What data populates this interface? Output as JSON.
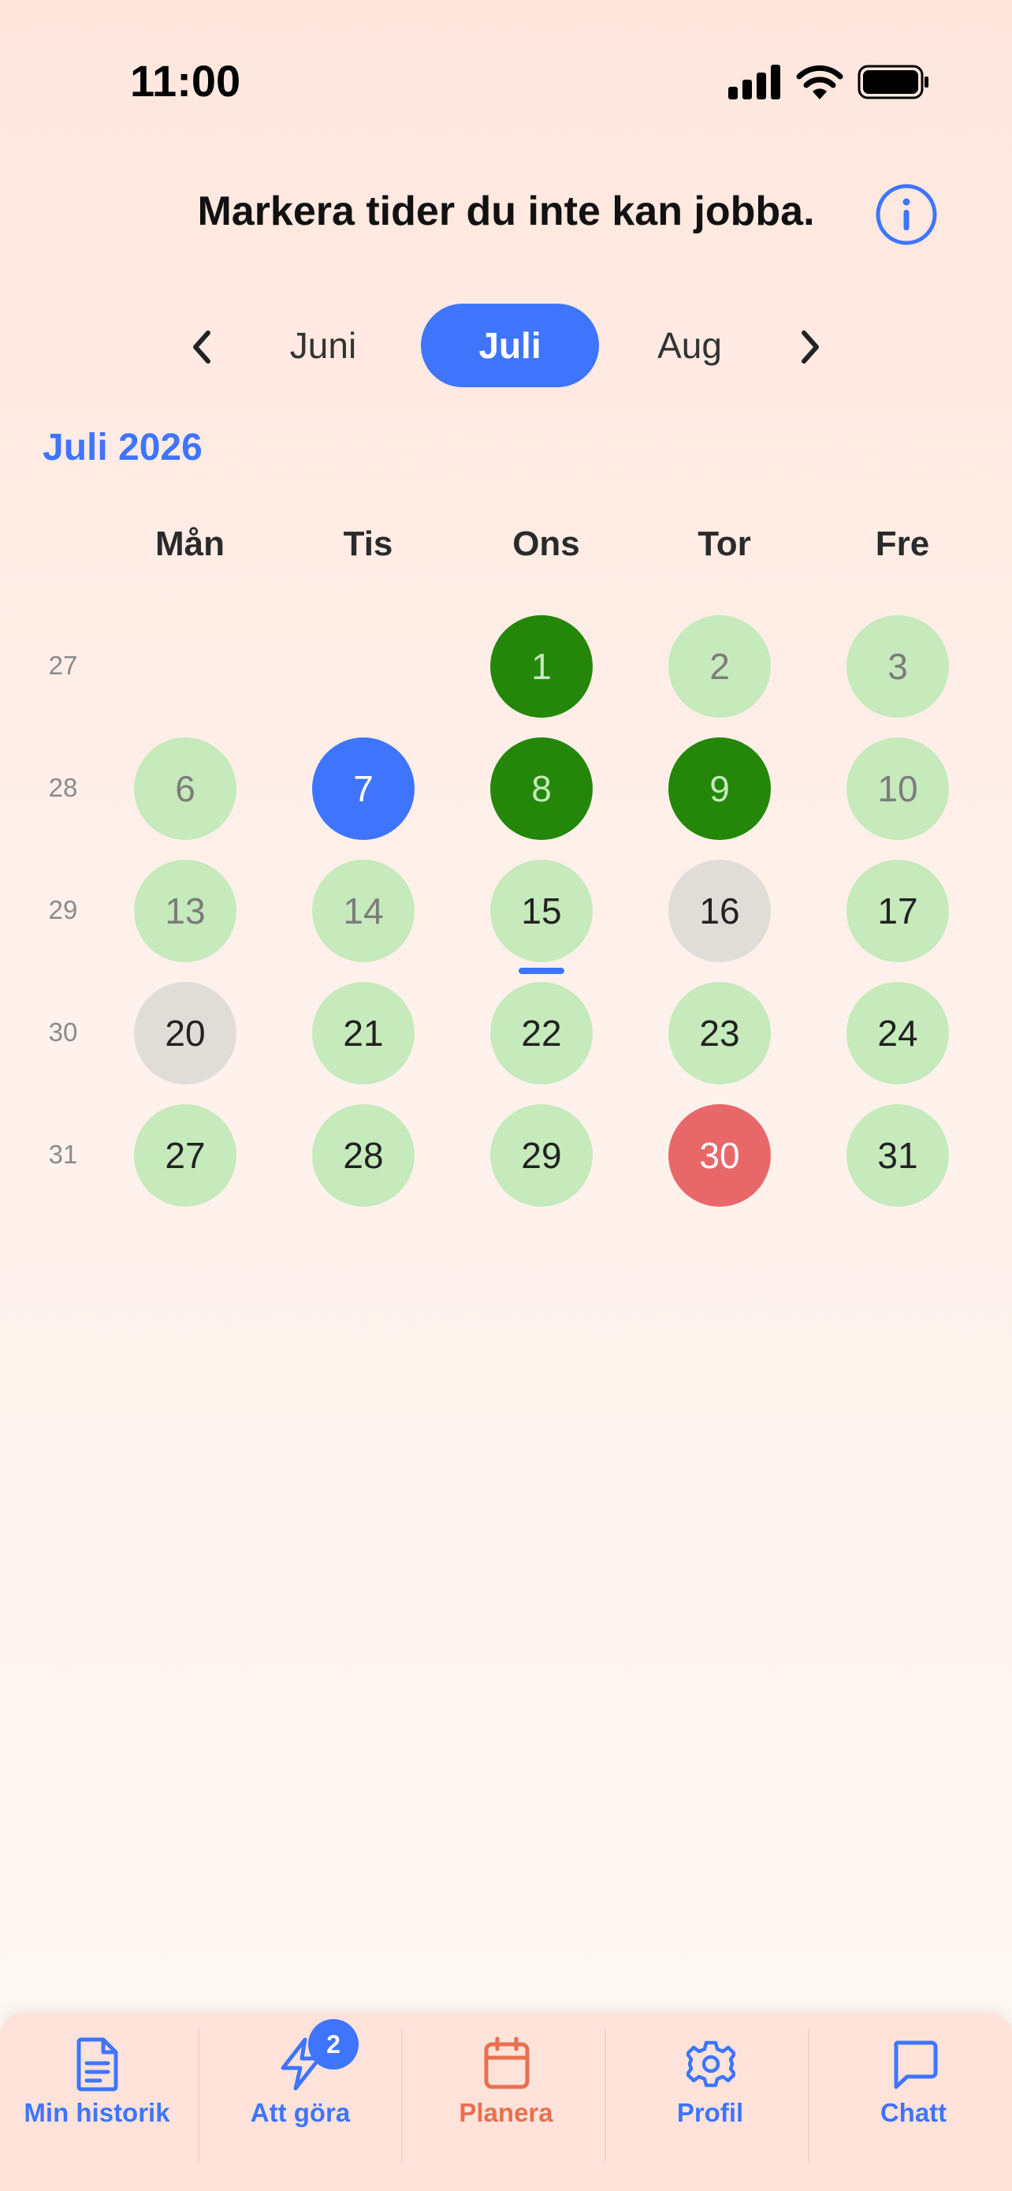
{
  "status_bar": {
    "time": "11:00",
    "icons": [
      "signal-icon",
      "wifi-icon",
      "battery-icon"
    ]
  },
  "header": {
    "title": "Markera tider du inte kan jobba.",
    "info_icon": "info-icon"
  },
  "month_nav": {
    "prev_icon": "chevron-left-icon",
    "next_icon": "chevron-right-icon",
    "prev_label": "Juni",
    "current_label": "Juli",
    "next_label": "Aug"
  },
  "calendar": {
    "month_title": "Juli 2026",
    "weekdays": [
      "Mån",
      "Tis",
      "Ons",
      "Tor",
      "Fre"
    ],
    "weeks": [
      {
        "number": "27",
        "days": [
          null,
          null,
          {
            "label": "1",
            "status": "dark"
          },
          {
            "label": "2",
            "status": "light-muted"
          },
          {
            "label": "3",
            "status": "light-muted"
          }
        ]
      },
      {
        "number": "28",
        "days": [
          {
            "label": "6",
            "status": "light-muted"
          },
          {
            "label": "7",
            "status": "blue"
          },
          {
            "label": "8",
            "status": "dark"
          },
          {
            "label": "9",
            "status": "dark"
          },
          {
            "label": "10",
            "status": "light-muted"
          }
        ]
      },
      {
        "number": "29",
        "days": [
          {
            "label": "13",
            "status": "light-muted"
          },
          {
            "label": "14",
            "status": "light-muted"
          },
          {
            "label": "15",
            "status": "light",
            "today": true
          },
          {
            "label": "16",
            "status": "gray"
          },
          {
            "label": "17",
            "status": "light"
          }
        ]
      },
      {
        "number": "30",
        "days": [
          {
            "label": "20",
            "status": "gray"
          },
          {
            "label": "21",
            "status": "light"
          },
          {
            "label": "22",
            "status": "light"
          },
          {
            "label": "23",
            "status": "light"
          },
          {
            "label": "24",
            "status": "light"
          }
        ]
      },
      {
        "number": "31",
        "days": [
          {
            "label": "27",
            "status": "light"
          },
          {
            "label": "28",
            "status": "light"
          },
          {
            "label": "29",
            "status": "light"
          },
          {
            "label": "30",
            "status": "red"
          },
          {
            "label": "31",
            "status": "light"
          }
        ]
      }
    ]
  },
  "tab_bar": {
    "items": [
      {
        "label": "Min historik",
        "icon": "document-icon"
      },
      {
        "label": "Att göra",
        "icon": "lightning-icon",
        "badge": "2"
      },
      {
        "label": "Planera",
        "icon": "calendar-icon",
        "active": true
      },
      {
        "label": "Profil",
        "icon": "gear-icon"
      },
      {
        "label": "Chatt",
        "icon": "chat-icon"
      }
    ]
  },
  "colors": {
    "accent_blue": "#3f75fd",
    "active_orange": "#e8704e",
    "available_light": "#c6eabb",
    "booked_dark_green": "#248709",
    "unavailable_gray": "#e0ddd8",
    "blocked_red": "#e8686a"
  }
}
